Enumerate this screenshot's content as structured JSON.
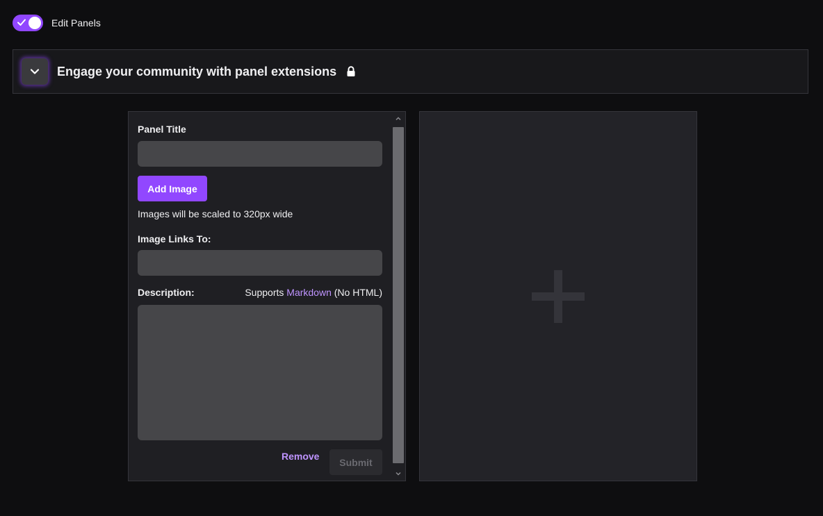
{
  "edit_panels": {
    "label": "Edit Panels",
    "enabled": true
  },
  "extensions_bar": {
    "title": "Engage your community with panel extensions",
    "toggle_icon": "chevron-down-icon",
    "status_icon": "lock-icon"
  },
  "panel_editor": {
    "title_label": "Panel Title",
    "title_value": "",
    "add_image_label": "Add Image",
    "image_hint": "Images will be scaled to 320px wide",
    "link_label": "Image Links To:",
    "link_value": "",
    "description_label": "Description:",
    "supports_prefix": "Supports ",
    "markdown_link": "Markdown",
    "supports_suffix": " (No HTML)",
    "description_value": "",
    "remove_label": "Remove",
    "submit_label": "Submit"
  },
  "add_panel": {
    "icon": "plus-icon"
  },
  "colors": {
    "accent": "#9147ff",
    "link": "#bf94ff",
    "background": "#0e0e10"
  }
}
